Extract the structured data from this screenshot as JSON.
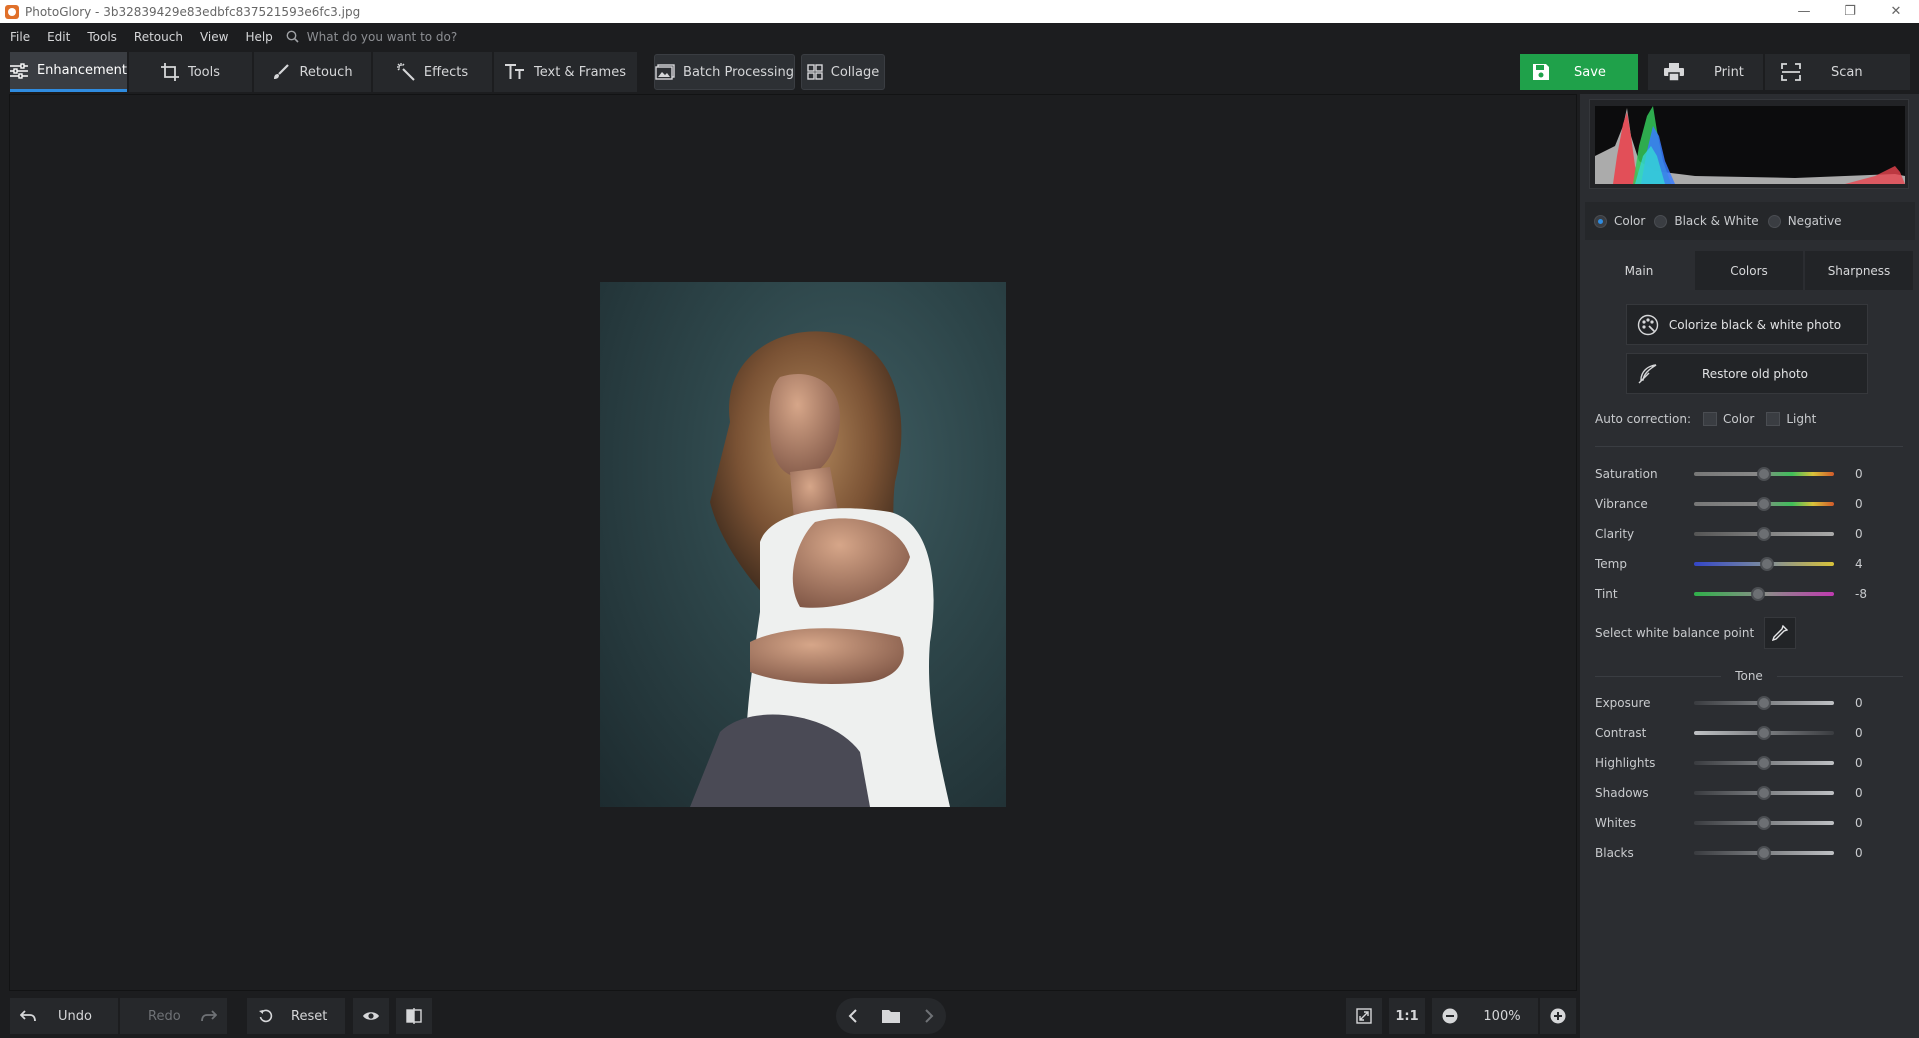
{
  "window": {
    "title": "PhotoGlory - 3b32839429e83edbfc837521593e6fc3.jpg",
    "controls": [
      "—",
      "❐",
      "✕"
    ]
  },
  "menu": {
    "items": [
      "File",
      "Edit",
      "Tools",
      "Retouch",
      "View",
      "Help"
    ],
    "search_placeholder": "What do you want to do?"
  },
  "toolbar": {
    "tabs": [
      "Enhancement",
      "Tools",
      "Retouch",
      "Effects",
      "Text & Frames"
    ],
    "active_tab": "Enhancement",
    "batch": "Batch Processing",
    "collage": "Collage",
    "save": "Save",
    "print": "Print",
    "scan": "Scan"
  },
  "bottom": {
    "undo": "Undo",
    "redo": "Redo",
    "reset": "Reset",
    "ratio": "1:1",
    "zoom": "100%"
  },
  "panel": {
    "modes": [
      {
        "label": "Color",
        "selected": true
      },
      {
        "label": "Black & White",
        "selected": false
      },
      {
        "label": "Negative",
        "selected": false
      }
    ],
    "tabs": [
      "Main",
      "Colors",
      "Sharpness"
    ],
    "active_tab": "Main",
    "colorize": "Colorize black & white photo",
    "restore": "Restore old photo",
    "auto_correction": {
      "label": "Auto correction:",
      "color": "Color",
      "light": "Light"
    },
    "color_sliders": [
      {
        "label": "Saturation",
        "value": "0",
        "level": 0.5
      },
      {
        "label": "Vibrance",
        "value": "0",
        "level": 0.5
      },
      {
        "label": "Clarity",
        "value": "0",
        "level": 0.5
      },
      {
        "label": "Temp",
        "value": "4",
        "level": 0.52
      },
      {
        "label": "Tint",
        "value": "-8",
        "level": 0.46
      }
    ],
    "white_balance": "Select white balance point",
    "tone_header": "Tone",
    "tone_sliders": [
      {
        "label": "Exposure",
        "value": "0",
        "level": 0.5
      },
      {
        "label": "Contrast",
        "value": "0",
        "level": 0.5
      },
      {
        "label": "Highlights",
        "value": "0",
        "level": 0.5
      },
      {
        "label": "Shadows",
        "value": "0",
        "level": 0.5
      },
      {
        "label": "Whites",
        "value": "0",
        "level": 0.5
      },
      {
        "label": "Blacks",
        "value": "0",
        "level": 0.5
      }
    ],
    "colors": {
      "accent": "#2f8ce0",
      "save_green": "#1fa14a"
    }
  }
}
